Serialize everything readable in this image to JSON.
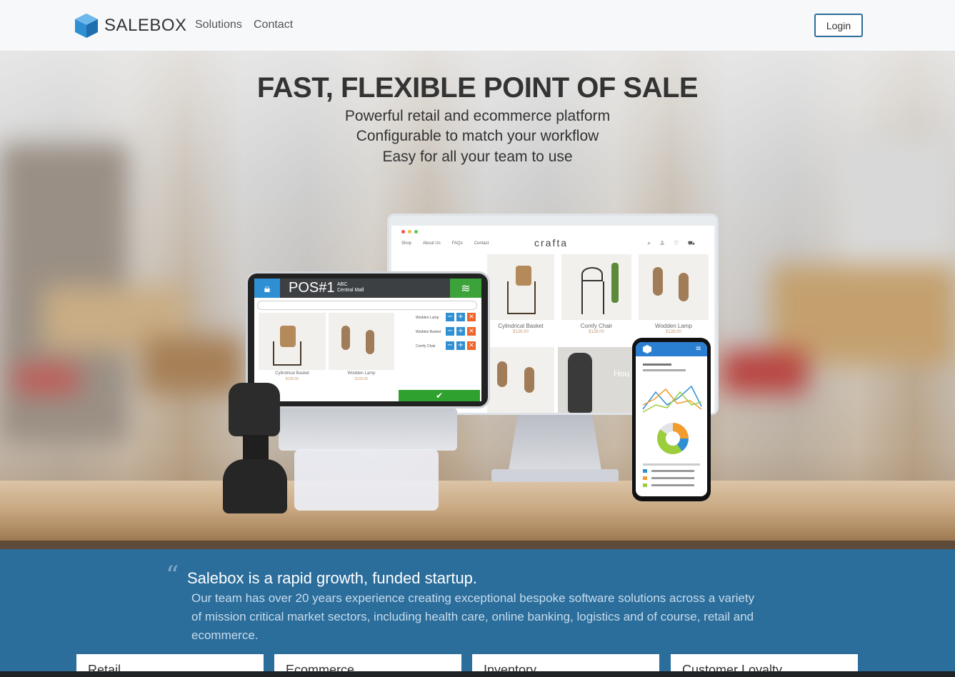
{
  "navbar": {
    "brand": "SALEBOX",
    "links": [
      "Solutions",
      "Contact"
    ],
    "login_label": "Login"
  },
  "hero": {
    "title": "FAST, FLEXIBLE POINT OF SALE",
    "subtitles": [
      "Powerful retail and ecommerce platform",
      "Configurable to match your workflow",
      "Easy for all your team to use"
    ]
  },
  "monitor": {
    "nav_items": [
      "Shop",
      "About Us",
      "FAQs",
      "Contact"
    ],
    "logo": "crafta",
    "products": [
      {
        "name": "Cylindrical Basket",
        "price": "$128.00"
      },
      {
        "name": "Comfy Chair",
        "price": "$128.00"
      },
      {
        "name": "Wodden Lamp",
        "price": "$128.00"
      }
    ],
    "banner_text": "Hou"
  },
  "tablet": {
    "pos_title": "POS#1",
    "location_line1": "ABC",
    "location_line2": "Central Mall",
    "products": [
      {
        "name": "Cylindrical Basket",
        "price": "$128.00"
      },
      {
        "name": "Wodden Lamp",
        "price": "$128.00"
      }
    ],
    "cart_items": [
      "Wodden Lamp",
      "Wodden Basket",
      "Comfy Chair"
    ]
  },
  "about": {
    "title": "Salebox is a rapid growth, funded startup.",
    "body": "Our team has over 20 years experience creating exceptional bespoke software solutions across a variety of mission critical market sectors, including health care, online banking, logistics and of course, retail and ecommerce."
  },
  "cards": [
    "Retail",
    "Ecommerce",
    "Inventory",
    "Customer Loyalty"
  ],
  "colors": {
    "brand_blue": "#2b6d9b",
    "accent_blue": "#2f8fd3",
    "pos_green": "#2fa12f"
  }
}
